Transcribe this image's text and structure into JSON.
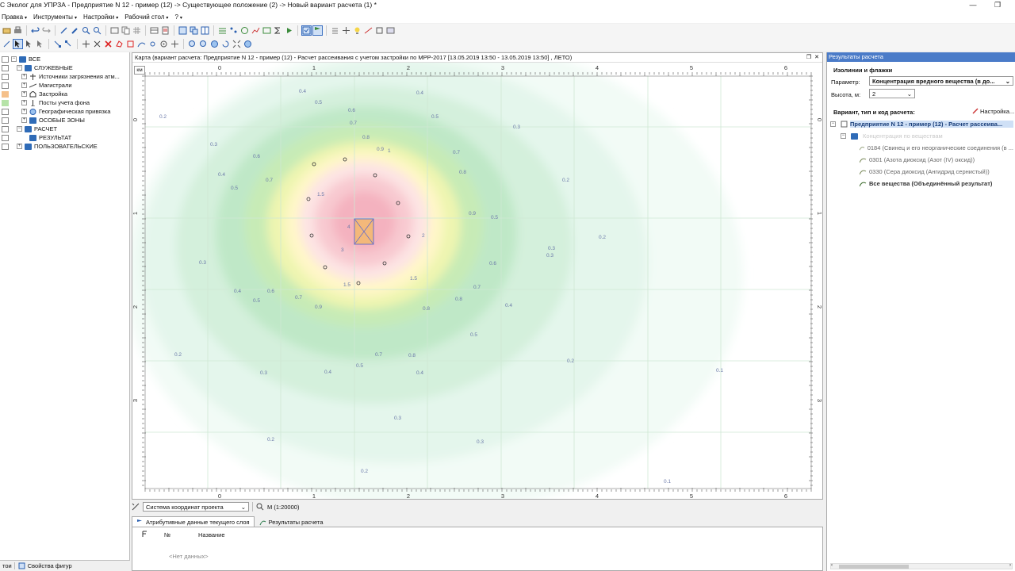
{
  "window": {
    "title": "С Эколог для УПРЗА - Предприятие N 12 - пример (12) -> Существующее положение (2) -> Новый вариант расчета (1) *"
  },
  "menu": [
    {
      "label": "Правка"
    },
    {
      "label": "Инструменты"
    },
    {
      "label": "Настройки"
    },
    {
      "label": "Рабочий стол"
    },
    {
      "label": "?"
    }
  ],
  "layers_tree": {
    "items": [
      {
        "label": "ВСЕ",
        "color": "",
        "icon": "folder-icon"
      },
      {
        "label": "СЛУЖЕБНЫЕ",
        "color": "",
        "icon": "folder-icon"
      },
      {
        "label": "Источники загрязнения атм...",
        "color": "",
        "icon": "emission-source-icon"
      },
      {
        "label": "Магистрали",
        "color": "",
        "icon": "road-icon"
      },
      {
        "label": "Застройка",
        "color": "#f5c08a",
        "icon": "building-icon"
      },
      {
        "label": "Посты учета фона",
        "color": "#b6e3a8",
        "icon": "post-icon"
      },
      {
        "label": "Географическая привязка",
        "color": "",
        "icon": "globe-icon"
      },
      {
        "label": "ОСОБЫЕ ЗОНЫ",
        "color": "",
        "icon": "folder-icon"
      },
      {
        "label": "РАСЧЕТ",
        "color": "",
        "icon": "folder-icon"
      },
      {
        "label": "РЕЗУЛЬТАТ",
        "color": "",
        "icon": "folder-icon"
      },
      {
        "label": "ПОЛЬЗОВАТЕЛЬСКИЕ",
        "color": "",
        "icon": "folder-icon"
      }
    ],
    "bottom_left": "тои",
    "bottom_tab": "Свойства фигур"
  },
  "map": {
    "header": "Карта (вариант расчета: Предприятие N 12 - пример (12) - Расчет рассеивания с учетом застройки по МРР-2017 [13.05.2019 13:50 - 13.05.2019 13:50] , ЛЕТО)",
    "unit": "км",
    "x_ticks": [
      "0",
      "1",
      "2",
      "3",
      "4",
      "5",
      "6"
    ],
    "y_ticks": [
      "0",
      "1",
      "2",
      "3"
    ],
    "contour_labels": [
      "0.4",
      "0.5",
      "0.6",
      "0.7",
      "0.8",
      "0.9",
      "1",
      "1.5",
      "2",
      "3",
      "4",
      "0.3",
      "0.2",
      "0.1"
    ],
    "coord_system": "Система координат проекта",
    "scale": "М (1:20000)"
  },
  "bottom_tabs": [
    {
      "label": "Атрибутивные данные текущего слоя"
    },
    {
      "label": "Результаты расчета"
    }
  ],
  "attr_table": {
    "columns": [
      "№",
      "Название"
    ],
    "empty": "<Нет данных>"
  },
  "results": {
    "panel_title": "Результаты расчета",
    "section": "Изолинии и флажки",
    "param_label": "Параметр:",
    "param_value": "Концентрация вредного вещества (в до...",
    "height_label": "Высота, м:",
    "height_value": "2",
    "variant_label": "Вариант, тип и код расчета:",
    "settings_label": "Настройка...",
    "tree": [
      {
        "label": "Предприятие N 12 - пример (12) - Расчет рассеива..."
      },
      {
        "label": "Концентрация по веществам"
      },
      {
        "label": "0184 (Свинец и его неорганические соединения (в ..."
      },
      {
        "label": "0301 (Азота диоксид (Азот (IV) оксид))"
      },
      {
        "label": "0330 (Сера диоксид (Ангидрид сернистый))"
      },
      {
        "label": "Все вещества (Объединённый результат)"
      }
    ]
  }
}
